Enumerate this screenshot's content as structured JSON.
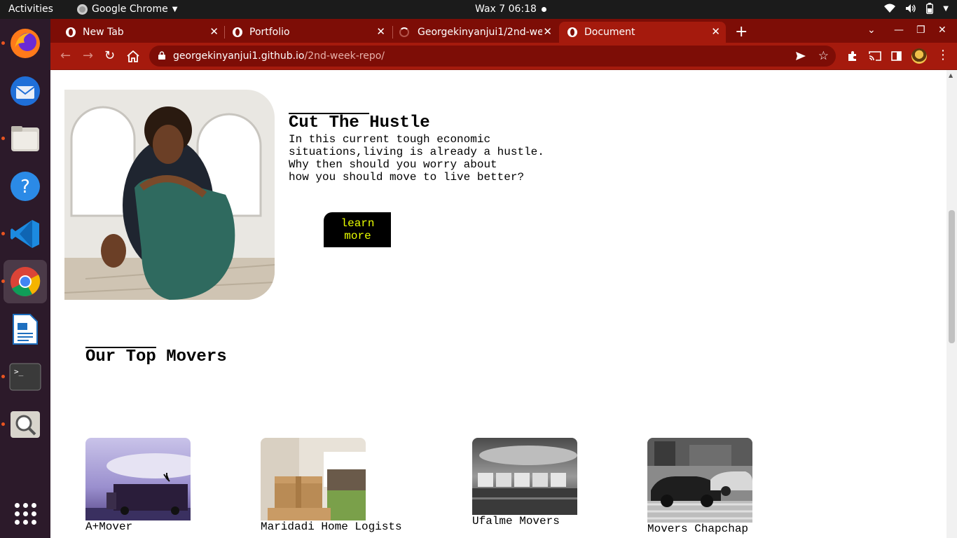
{
  "system": {
    "activities": "Activities",
    "app_name": "Google Chrome",
    "clock": "Wax 7  06:18"
  },
  "browser": {
    "tabs": [
      {
        "title": "New Tab",
        "active": false
      },
      {
        "title": "Portfolio",
        "active": false
      },
      {
        "title": "Georgekinyanjui1/2nd-we",
        "active": false
      },
      {
        "title": "Document",
        "active": true
      }
    ],
    "url_host": "georgekinyanjui1.github.io",
    "url_path": "/2nd-week-repo/",
    "theme_color": "#a51a0d"
  },
  "dock": [
    "firefox-icon",
    "thunderbird-icon",
    "files-icon",
    "help-icon",
    "vscode-icon",
    "chrome-icon",
    "writer-icon",
    "terminal-icon",
    "search-tool-icon",
    "show-apps-icon"
  ],
  "hero": {
    "title": "Cut The Hustle",
    "text": "In this current tough economic\nsituations,living is already a hustle.\nWhy then should you worry about\nhow you should move to live better?",
    "button": "learn more",
    "button_text_color": "#e9ff00"
  },
  "movers": {
    "title": "Our Top Movers",
    "items": [
      {
        "name": "A+Mover"
      },
      {
        "name": "Maridadi Home Logists"
      },
      {
        "name": "Ufalme Movers"
      },
      {
        "name": "Movers Chapchap"
      }
    ]
  }
}
